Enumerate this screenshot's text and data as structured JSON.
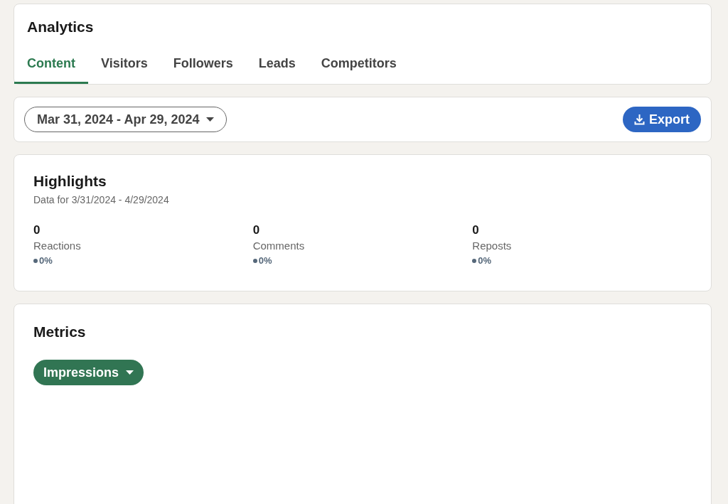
{
  "header": {
    "title": "Analytics"
  },
  "tabs": [
    {
      "label": "Content",
      "selected": true
    },
    {
      "label": "Visitors",
      "selected": false
    },
    {
      "label": "Followers",
      "selected": false
    },
    {
      "label": "Leads",
      "selected": false
    },
    {
      "label": "Competitors",
      "selected": false
    }
  ],
  "toolbar": {
    "date_range": "Mar 31, 2024 - Apr 29, 2024",
    "export_button": "Export"
  },
  "highlights": {
    "title": "Highlights",
    "subtitle": "Data for 3/31/2024 - 4/29/2024",
    "stats": [
      {
        "value": "0",
        "label": "Reactions",
        "change": "0%"
      },
      {
        "value": "0",
        "label": "Comments",
        "change": "0%"
      },
      {
        "value": "0",
        "label": "Reposts",
        "change": "0%"
      }
    ]
  },
  "metrics": {
    "title": "Metrics",
    "selector": "Impressions"
  }
}
